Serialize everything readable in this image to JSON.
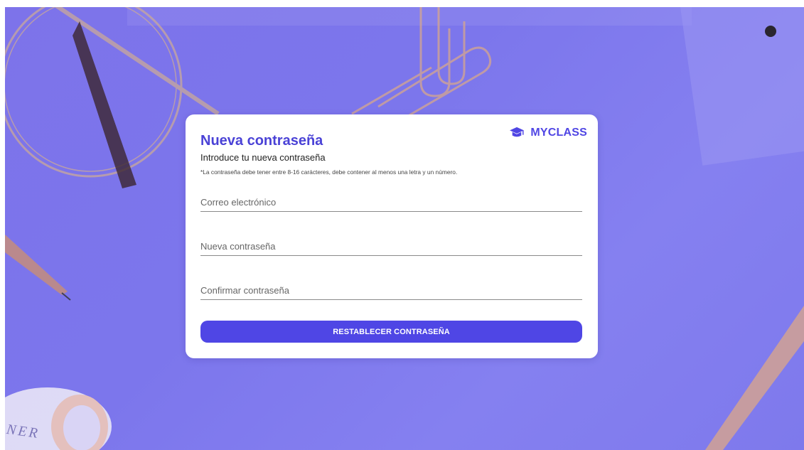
{
  "brand": {
    "name": "MYCLASS",
    "icon": "graduation-cap-icon",
    "color": "#5046e4"
  },
  "form": {
    "title": "Nueva contraseña",
    "subtitle": "Introduce tu nueva contraseña",
    "hint": "*La contraseña debe tener entre 8-16 carácteres, debe contener al menos una letra y un número.",
    "fields": [
      {
        "placeholder": "Correo electrónico",
        "value": ""
      },
      {
        "placeholder": "Nueva contraseña",
        "value": ""
      },
      {
        "placeholder": "Confirmar contraseña",
        "value": ""
      }
    ],
    "submit_label": "RESTABLECER CONTRASEÑA"
  },
  "background": {
    "decor_text": "NER",
    "accent": "#7d73ea"
  },
  "colors": {
    "button": "#4f46e5",
    "title": "#4a42d6"
  }
}
